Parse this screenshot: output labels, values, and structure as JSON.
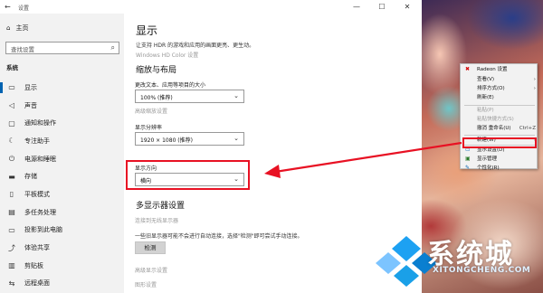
{
  "window": {
    "title": "设置",
    "back_glyph": "←",
    "minimize": "—",
    "maximize": "☐",
    "close": "✕"
  },
  "sidebar": {
    "home": "主页",
    "search_placeholder": "查找设置",
    "section": "系统",
    "items": [
      {
        "label": "显示",
        "icon": "monitor-icon",
        "active": true
      },
      {
        "label": "声音",
        "icon": "speaker-icon"
      },
      {
        "label": "通知和操作",
        "icon": "notification-icon"
      },
      {
        "label": "专注助手",
        "icon": "moon-icon"
      },
      {
        "label": "电源和睡眠",
        "icon": "power-icon"
      },
      {
        "label": "存储",
        "icon": "storage-icon"
      },
      {
        "label": "平板模式",
        "icon": "tablet-icon"
      },
      {
        "label": "多任务处理",
        "icon": "multitask-icon"
      },
      {
        "label": "投影到此电脑",
        "icon": "project-icon"
      },
      {
        "label": "体验共享",
        "icon": "share-icon"
      },
      {
        "label": "剪贴板",
        "icon": "clipboard-icon"
      },
      {
        "label": "远程桌面",
        "icon": "remote-icon"
      }
    ]
  },
  "main": {
    "title": "显示",
    "subtitle": "让支持 HDR 的游戏和应用的画面更亮、更生动。",
    "hdr_link": "Windows HD Color 设置",
    "scale_heading": "缩放与布局",
    "scale_label": "更改文本、应用等项目的大小",
    "scale_value": "100% (推荐)",
    "advanced_scale_link": "高级缩放设置",
    "resolution_label": "显示分辨率",
    "resolution_value": "1920 × 1080 (推荐)",
    "orientation_label": "显示方向",
    "orientation_value": "横向",
    "multi_heading": "多显示器设置",
    "wireless_link": "连接到无线显示器",
    "detect_desc": "一些旧显示器可能不会进行自动连接，选择\"检测\"即可尝试手动连接。",
    "detect_button": "检测",
    "advanced_display_link": "高级显示设置",
    "graphics_link": "图形设置"
  },
  "context_menu": {
    "items": [
      {
        "label": "Radeon 设置",
        "icon": "radeon-icon"
      },
      {
        "label": "查看(V)",
        "submenu": true
      },
      {
        "label": "排序方式(O)",
        "submenu": true
      },
      {
        "label": "刷新(E)"
      },
      {
        "label": "粘贴(P)",
        "disabled": true
      },
      {
        "label": "粘贴快捷方式(S)",
        "disabled": true
      },
      {
        "label": "撤消 重命名(U)",
        "shortcut": "Ctrl+Z"
      },
      {
        "label": "新建(W)",
        "submenu": true
      },
      {
        "label": "显示设置(D)",
        "icon": "display-settings-icon"
      },
      {
        "label": "显示管理",
        "icon": "display-manage-icon"
      },
      {
        "label": "个性化(R)",
        "icon": "personalize-icon"
      }
    ]
  },
  "watermark": {
    "text_zh": "系统城",
    "text_en": "XITONGCHENG.COM"
  },
  "colors": {
    "accent": "#0063b1",
    "highlight": "#e81123",
    "sidebar_bg": "#f2f2f2"
  }
}
